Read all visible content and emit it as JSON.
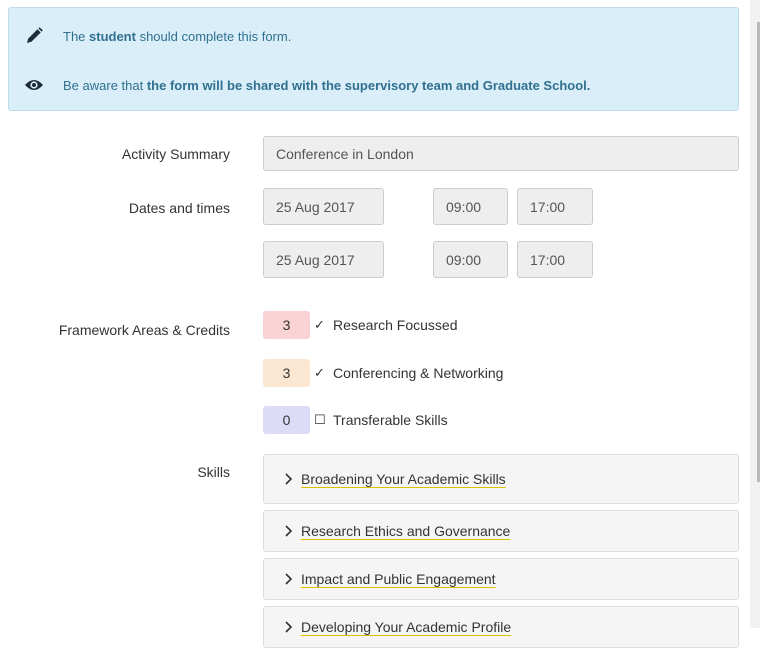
{
  "info": {
    "line1_prefix": "The ",
    "line1_bold": "student",
    "line1_suffix": " should complete this form.",
    "line2_prefix": "Be aware that ",
    "line2_bold": "the form will be shared with the supervisory team and Graduate School.",
    "icons": [
      "pencil-icon",
      "eye-icon"
    ]
  },
  "form": {
    "activity_label": "Activity Summary",
    "activity_value": "Conference in London",
    "dates_label": "Dates and times",
    "dates": [
      {
        "date": "25 Aug 2017",
        "start": "09:00",
        "end": "17:00"
      },
      {
        "date": "25 Aug 2017",
        "start": "09:00",
        "end": "17:00"
      }
    ],
    "framework_label": "Framework Areas & Credits",
    "framework": [
      {
        "credits": "3",
        "mark": "✓",
        "label": "Research Focussed",
        "checked": true,
        "color": "#f9d3d3"
      },
      {
        "credits": "3",
        "mark": "✓",
        "label": "Conferencing & Networking",
        "checked": true,
        "color": "#fbe6d1"
      },
      {
        "credits": "0",
        "mark": "☐",
        "label": "Transferable Skills",
        "checked": false,
        "color": "#dcdcf8"
      }
    ],
    "skills_label": "Skills",
    "skills": [
      {
        "label": "Broadening Your Academic Skills"
      },
      {
        "label": "Research Ethics and Governance"
      },
      {
        "label": "Impact and Public Engagement"
      },
      {
        "label": "Developing Your Academic Profile"
      }
    ]
  }
}
